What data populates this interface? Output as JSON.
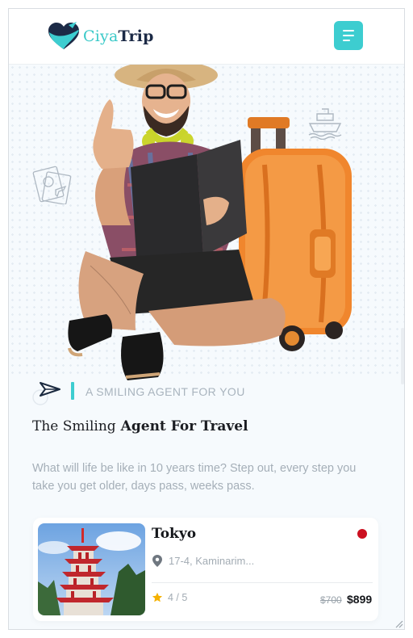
{
  "header": {
    "logo_part1": "Ciya",
    "logo_part2": "Trip",
    "menu_icon": "hamburger-menu-icon"
  },
  "hero": {
    "image": "smiling traveler with suitcase",
    "decor_icons": [
      "ship-icon",
      "passport-icon"
    ]
  },
  "intro": {
    "tagline": "A SMILING AGENT FOR YOU",
    "title_part1": "The Smiling",
    "title_part2": "Agent For Travel",
    "description": "What will life be like in 10 years time? Step out, every step you take you get older, days pass, weeks pass."
  },
  "card": {
    "title": "Tokyo",
    "location": "17-4, Kaminarim...",
    "rating": "4 / 5",
    "price_old": "$700",
    "price_new": "$899",
    "flag_color": "#cc1020"
  },
  "colors": {
    "accent": "#3dcdd0",
    "dark": "#1c2a46",
    "star": "#f5b100"
  }
}
